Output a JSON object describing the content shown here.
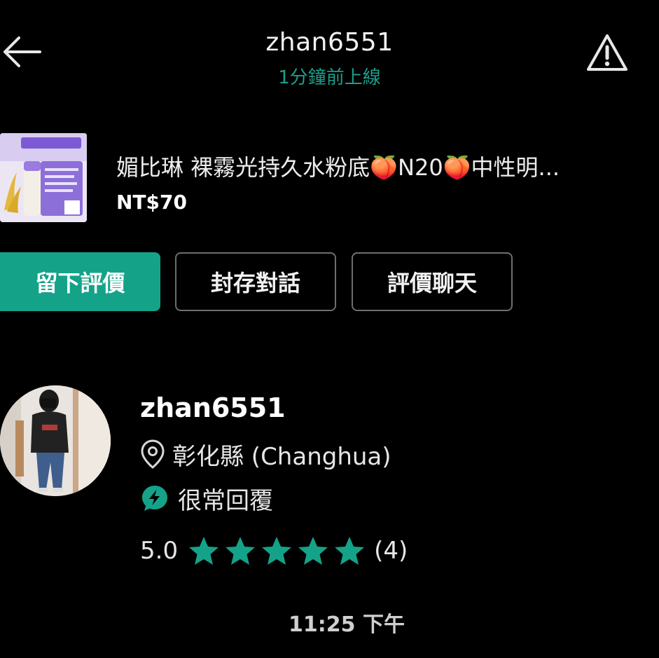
{
  "header": {
    "title": "zhan6551",
    "status": "1分鐘前上線"
  },
  "product": {
    "title": "媚比琳 裸霧光持久水粉底🍑N20🍑中性明...",
    "price": "NT$70"
  },
  "actions": {
    "leave_review": "留下評價",
    "archive_chat": "封存對話",
    "rate_chat": "評價聊天"
  },
  "profile": {
    "username": "zhan6551",
    "location": "彰化縣 (Changhua)",
    "response": "很常回覆",
    "rating": "5.0",
    "rating_count": "(4)",
    "stars": 5
  },
  "timestamp": "11:25 下午",
  "colors": {
    "accent": "#14a389",
    "status_text": "#1e9e8a",
    "background": "#000000"
  },
  "icons": {
    "back": "arrow-left-icon",
    "report": "warning-triangle-icon",
    "location": "map-pin-icon",
    "response": "lightning-bolt-icon",
    "star": "star-icon"
  }
}
